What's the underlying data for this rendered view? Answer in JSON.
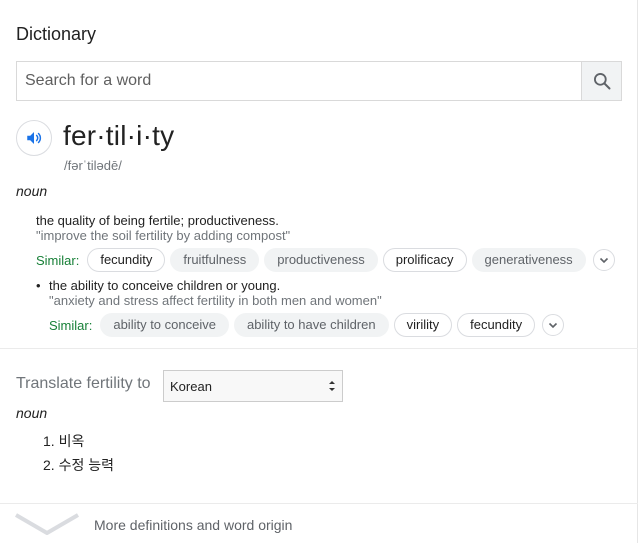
{
  "panel": {
    "title": "Dictionary"
  },
  "search": {
    "placeholder": "Search for a word"
  },
  "entry": {
    "headword": "fer·til·i·ty",
    "phonetic": "/fərˈtilədē/",
    "part_of_speech": "noun",
    "senses": [
      {
        "definition": "the quality of being fertile; productiveness.",
        "example": "\"improve the soil fertility by adding compost\"",
        "similar_label": "Similar:",
        "similar": [
          "fecundity",
          "fruitfulness",
          "productiveness",
          "prolificacy",
          "generativeness"
        ]
      },
      {
        "bullet": "•",
        "definition": "the ability to conceive children or young.",
        "example": "\"anxiety and stress affect fertility in both men and women\"",
        "similar_label": "Similar:",
        "similar": [
          "ability to conceive",
          "ability to have children",
          "virility",
          "fecundity"
        ]
      }
    ]
  },
  "translate": {
    "label": "Translate fertility to",
    "language": "Korean",
    "part_of_speech": "noun",
    "items": [
      "1. 비옥",
      "2. 수정 능력"
    ]
  },
  "footer": {
    "text": "More definitions and word origin"
  },
  "colors": {
    "similar_green": "#188038",
    "accent_blue": "#1a73e8",
    "chip_bg": "#f1f3f4"
  }
}
